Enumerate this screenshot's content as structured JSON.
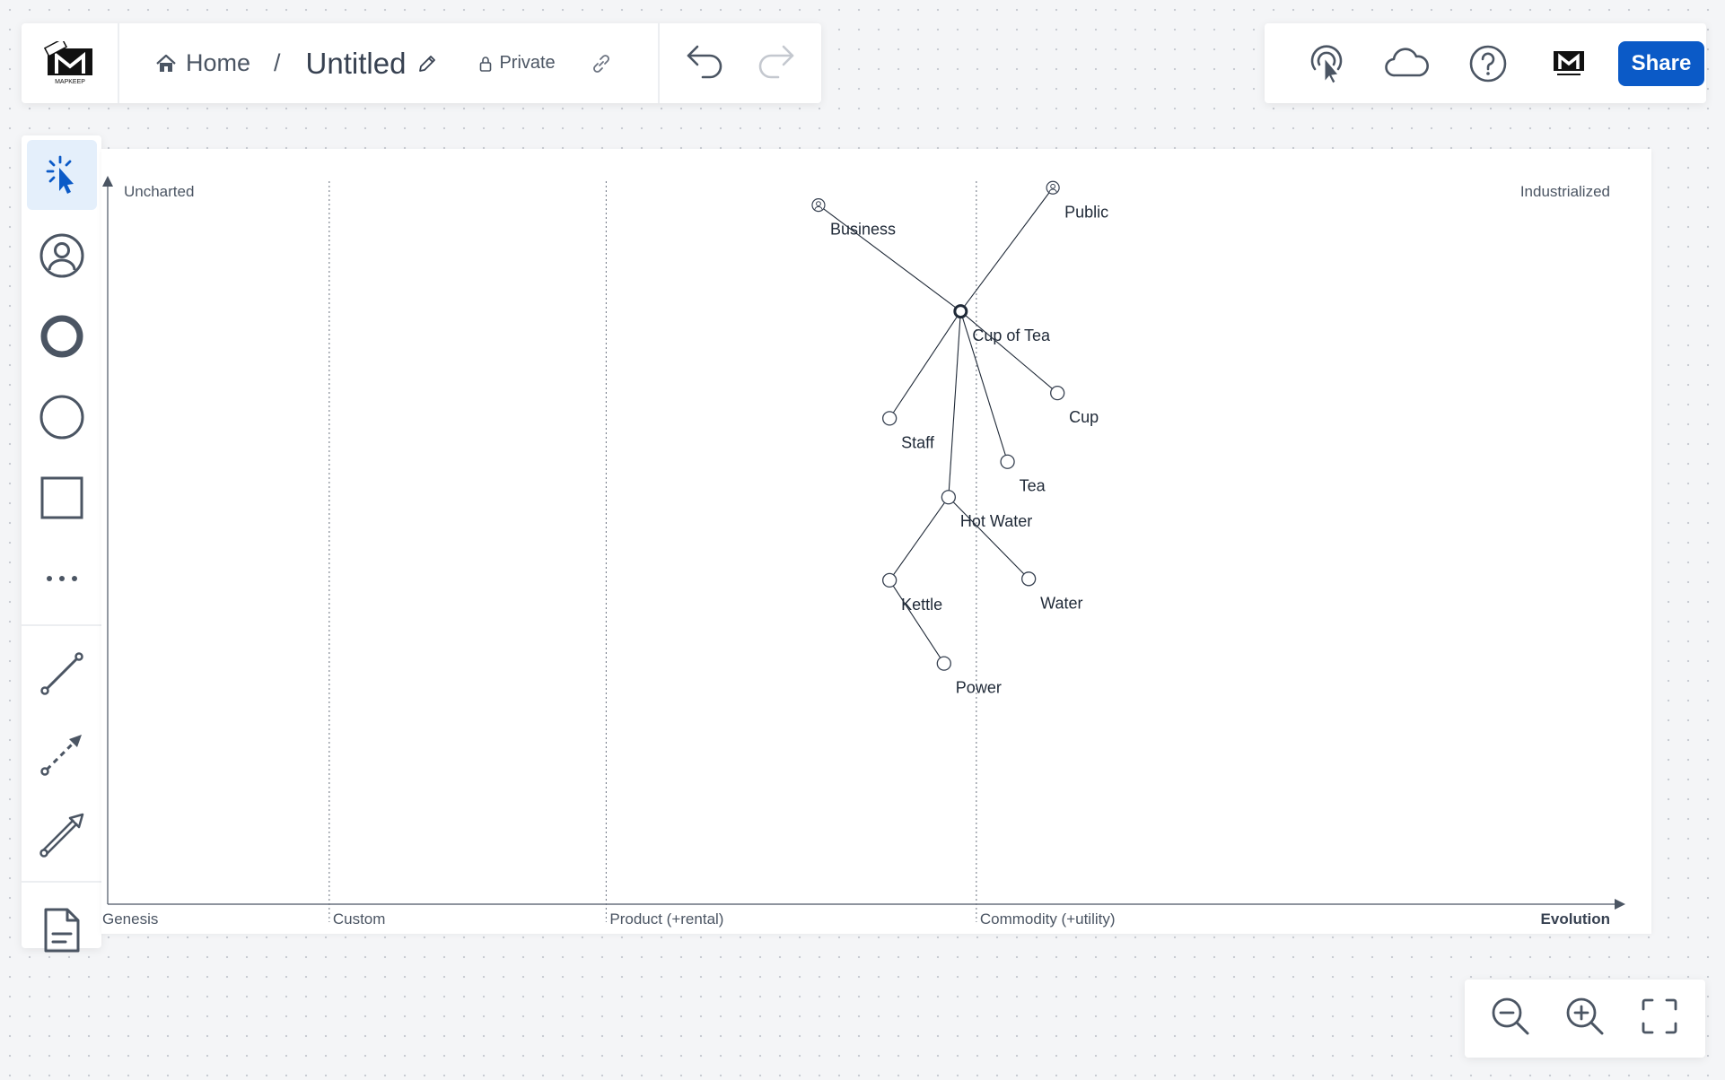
{
  "app": {
    "logo_text": "MAPKEEP"
  },
  "breadcrumb": {
    "home": "Home",
    "separator": "/",
    "title": "Untitled"
  },
  "visibility": "Private",
  "toolbar": {
    "share_label": "Share"
  },
  "map": {
    "y_axis_top": "Uncharted",
    "y_axis_bottom": "Industrialized",
    "evolution_label": "Evolution",
    "stages": [
      "Genesis",
      "Custom",
      "Product (+rental)",
      "Commodity (+utility)"
    ],
    "components": [
      {
        "id": "business",
        "label": "Business",
        "type": "user",
        "evolution": 0.47,
        "visibility": 0.967
      },
      {
        "id": "public",
        "label": "Public",
        "type": "user",
        "evolution": 0.625,
        "visibility": 0.991
      },
      {
        "id": "cup_of_tea",
        "label": "Cup of Tea",
        "type": "anchor",
        "evolution": 0.564,
        "visibility": 0.82
      },
      {
        "id": "staff",
        "label": "Staff",
        "type": "component",
        "evolution": 0.517,
        "visibility": 0.672
      },
      {
        "id": "cup",
        "label": "Cup",
        "type": "component",
        "evolution": 0.628,
        "visibility": 0.707
      },
      {
        "id": "tea",
        "label": "Tea",
        "type": "component",
        "evolution": 0.595,
        "visibility": 0.612
      },
      {
        "id": "hot_water",
        "label": "Hot Water",
        "type": "component",
        "evolution": 0.556,
        "visibility": 0.563
      },
      {
        "id": "kettle",
        "label": "Kettle",
        "type": "component",
        "evolution": 0.517,
        "visibility": 0.448
      },
      {
        "id": "water",
        "label": "Water",
        "type": "component",
        "evolution": 0.609,
        "visibility": 0.45
      },
      {
        "id": "power",
        "label": "Power",
        "type": "component",
        "evolution": 0.553,
        "visibility": 0.333
      }
    ],
    "links": [
      [
        "business",
        "cup_of_tea"
      ],
      [
        "public",
        "cup_of_tea"
      ],
      [
        "cup_of_tea",
        "staff"
      ],
      [
        "cup_of_tea",
        "cup"
      ],
      [
        "cup_of_tea",
        "tea"
      ],
      [
        "cup_of_tea",
        "hot_water"
      ],
      [
        "hot_water",
        "kettle"
      ],
      [
        "hot_water",
        "water"
      ],
      [
        "kettle",
        "power"
      ]
    ]
  }
}
